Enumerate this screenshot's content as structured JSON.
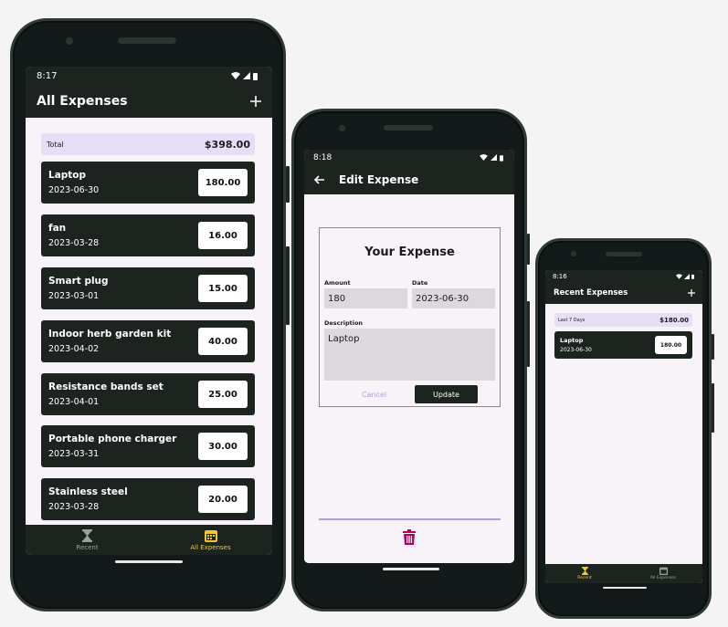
{
  "colors": {
    "bar": "#1d2420",
    "accent": "#f0c929",
    "total_bg": "#e6def6",
    "delete": "#b3005a"
  },
  "phone1": {
    "status": {
      "time": "8:17"
    },
    "appbar": {
      "title": "All Expenses",
      "add_icon": "plus-icon"
    },
    "total": {
      "label": "Total",
      "amount": "$398.00"
    },
    "expenses": [
      {
        "title": "Laptop",
        "date": "2023-06-30",
        "amount": "180.00"
      },
      {
        "title": "fan",
        "date": "2023-03-28",
        "amount": "16.00"
      },
      {
        "title": "Smart plug",
        "date": "2023-03-01",
        "amount": "15.00"
      },
      {
        "title": "Indoor herb garden kit",
        "date": "2023-04-02",
        "amount": "40.00"
      },
      {
        "title": "Resistance bands set",
        "date": "2023-04-01",
        "amount": "25.00"
      },
      {
        "title": "Portable phone charger",
        "date": "2023-03-31",
        "amount": "30.00"
      },
      {
        "title": "Stainless steel",
        "date": "2023-03-28",
        "amount": "20.00"
      }
    ],
    "nav": [
      {
        "label": "Recent",
        "icon": "hourglass-icon"
      },
      {
        "label": "All Expenses",
        "icon": "calendar-icon"
      }
    ]
  },
  "phone2": {
    "status": {
      "time": "8:18"
    },
    "appbar": {
      "title": "Edit Expense",
      "back_icon": "arrow-left-icon"
    },
    "form": {
      "title": "Your Expense",
      "amount_label": "Amount",
      "amount_value": "180",
      "date_label": "Date",
      "date_value": "2023-06-30",
      "description_label": "Description",
      "description_value": "Laptop",
      "cancel_label": "Cancel",
      "update_label": "Update"
    },
    "delete_icon": "trash-icon"
  },
  "phone3": {
    "status": {
      "time": "8:16"
    },
    "appbar": {
      "title": "Recent Expenses",
      "add_icon": "plus-icon"
    },
    "total": {
      "label": "Last 7 Days",
      "amount": "$180.00"
    },
    "expenses": [
      {
        "title": "Laptop",
        "date": "2023-06-30",
        "amount": "180.00"
      }
    ],
    "nav": [
      {
        "label": "Recent",
        "icon": "hourglass-icon"
      },
      {
        "label": "All Expenses",
        "icon": "calendar-icon"
      }
    ]
  }
}
